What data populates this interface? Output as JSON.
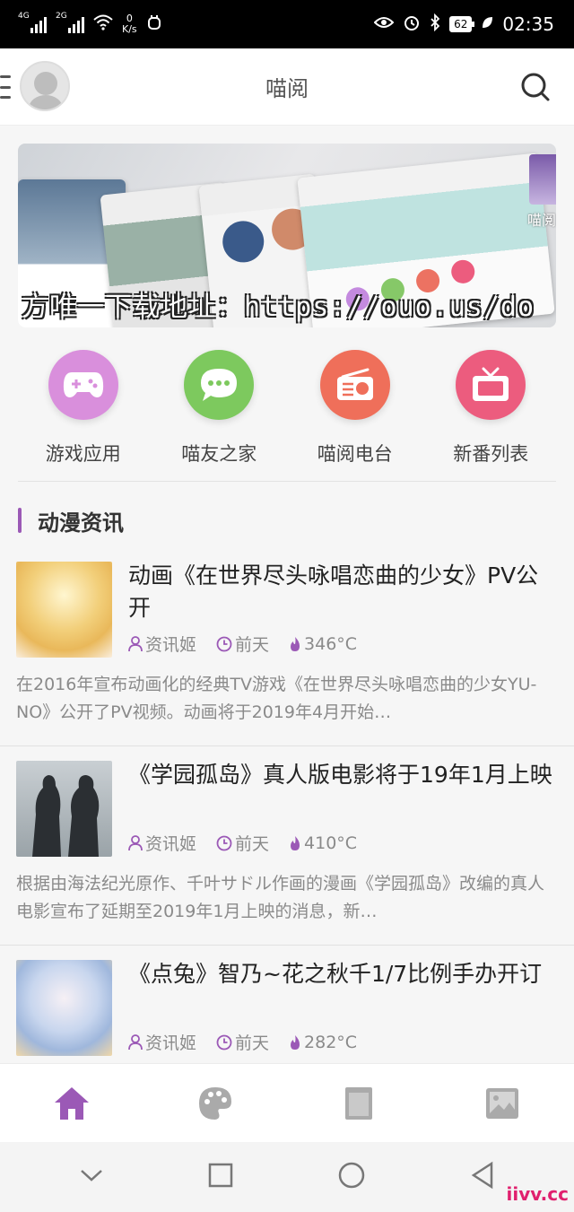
{
  "status_bar": {
    "network_1": "4G",
    "network_2": "2G",
    "speed_value": "0",
    "speed_unit": "K/s",
    "battery": "62",
    "time": "02:35"
  },
  "header": {
    "title": "喵阅"
  },
  "banner": {
    "caption": "方唯一下载地址：https://ouo.us/do",
    "side_text": "喵阅"
  },
  "shortcuts": [
    {
      "label": "游戏应用",
      "color": "#d98fdc",
      "icon": "gamepad-icon"
    },
    {
      "label": "喵友之家",
      "color": "#7dc95e",
      "icon": "chat-icon"
    },
    {
      "label": "喵阅电台",
      "color": "#ef6f5a",
      "icon": "radio-icon"
    },
    {
      "label": "新番列表",
      "color": "#ec5c7e",
      "icon": "tv-icon"
    }
  ],
  "section": {
    "title": "动漫资讯",
    "accent": "#9b59b6"
  },
  "news": [
    {
      "title": "动画《在世界尽头咏唱恋曲的少女》PV公开",
      "author": "资讯姬",
      "time": "前天",
      "heat": "346°C",
      "summary": "在2016年宣布动画化的经典TV游戏《在世界尽头咏唱恋曲的少女YU-NO》公开了PV视频。动画将于2019年4月开始…"
    },
    {
      "title": "《学园孤岛》真人版电影将于19年1月上映",
      "author": "资讯姬",
      "time": "前天",
      "heat": "410°C",
      "summary": "根据由海法纪光原作、千叶サドル作画的漫画《学园孤岛》改编的真人电影宣布了延期至2019年1月上映的消息，新…"
    },
    {
      "title": "《点兔》智乃~花之秋千1/7比例手办开订",
      "author": "资讯姬",
      "time": "前天",
      "heat": "282°C",
      "summary": ""
    }
  ],
  "tabs": [
    {
      "icon": "home-icon",
      "active": true
    },
    {
      "icon": "palette-icon",
      "active": false
    },
    {
      "icon": "book-icon",
      "active": false
    },
    {
      "icon": "image-icon",
      "active": false
    }
  ],
  "watermark": "iivv.cc"
}
